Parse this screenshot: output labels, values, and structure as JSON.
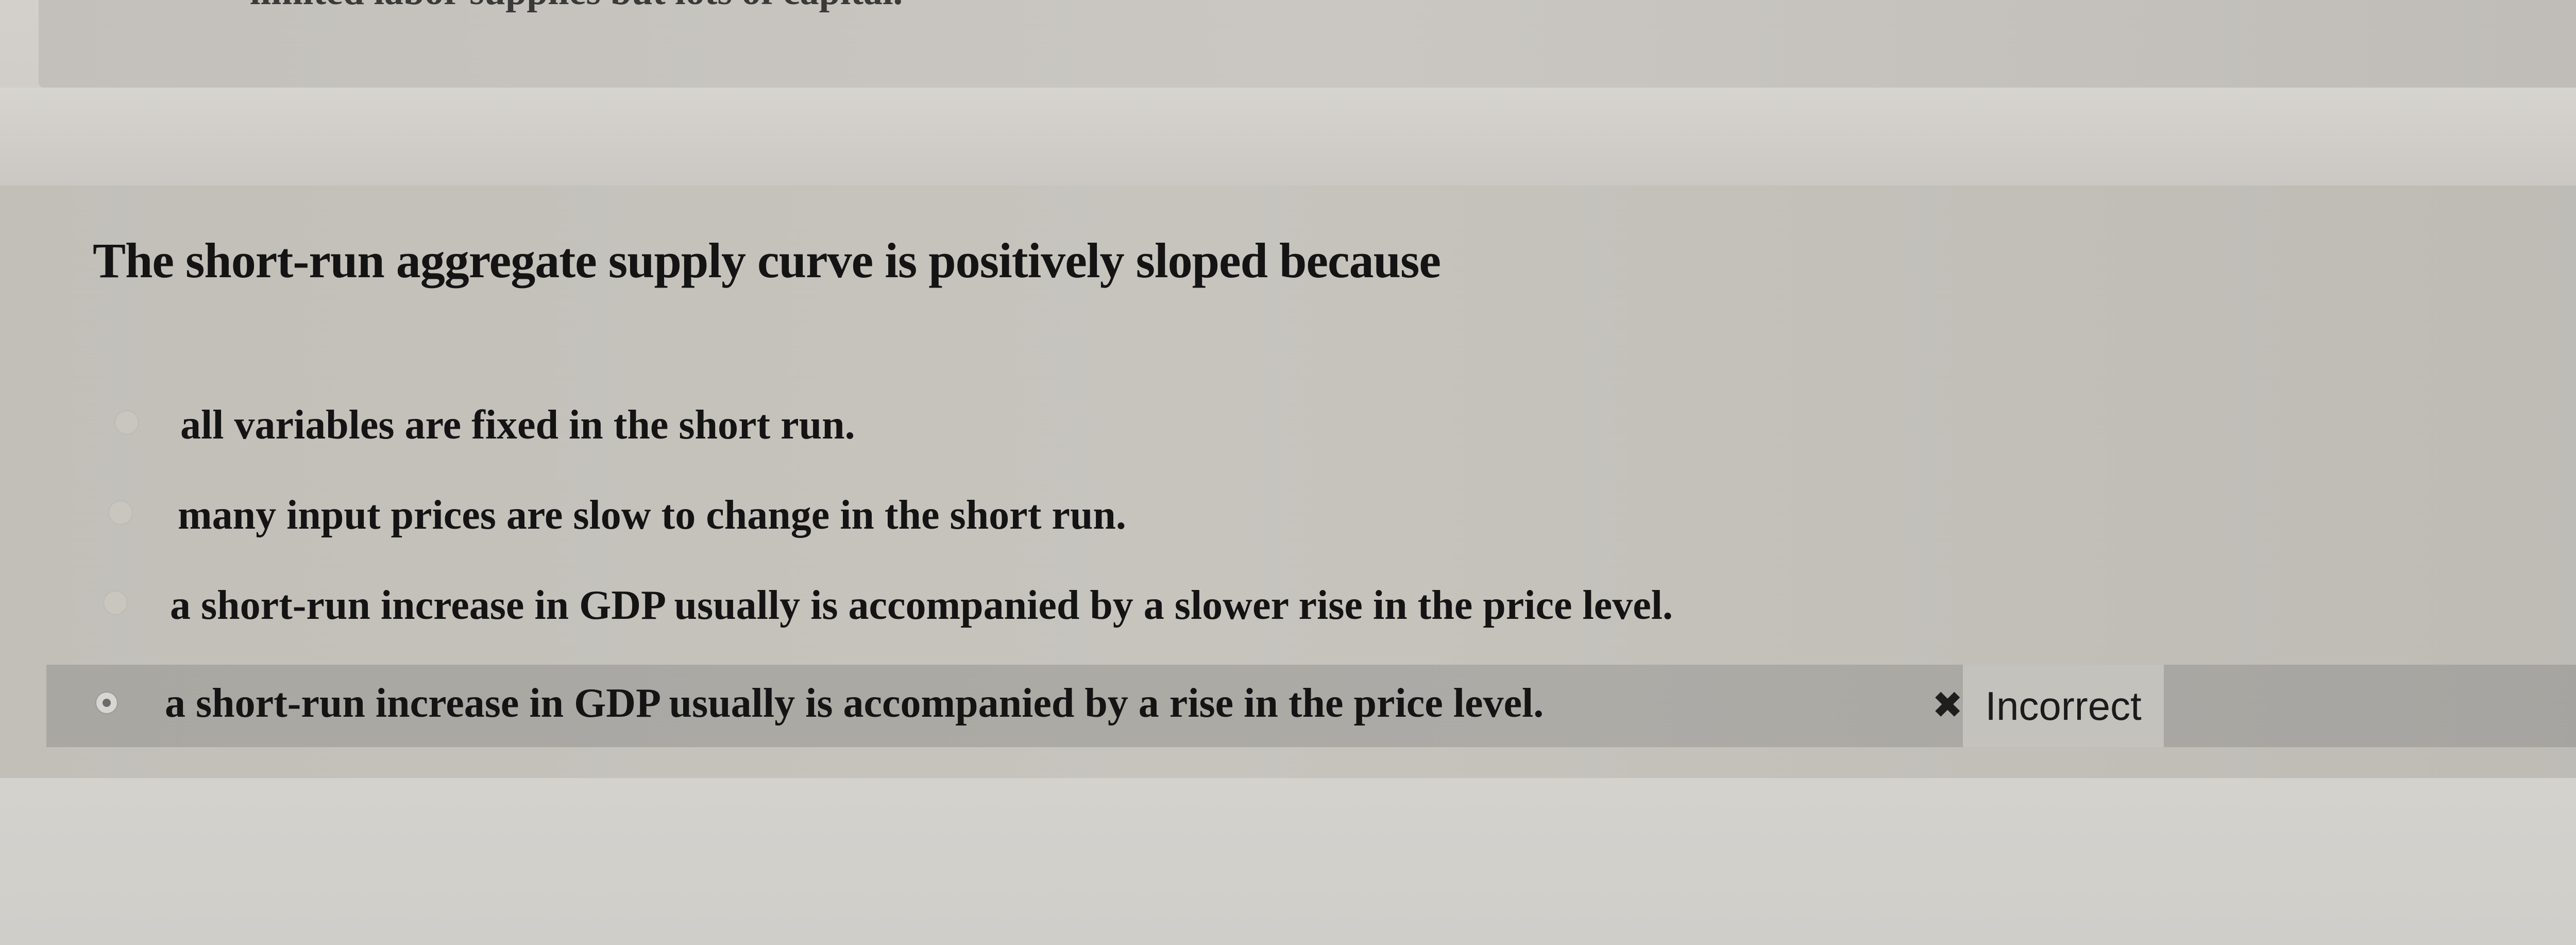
{
  "previous_item": {
    "clipped_text": "limited labor supplies but lots of capital."
  },
  "question": {
    "prompt": "The short-run aggregate supply curve is positively sloped because",
    "options": [
      {
        "label": "all variables are fixed in the short run.",
        "selected": false
      },
      {
        "label": "many input prices are slow to change in the short run.",
        "selected": false
      },
      {
        "label": "a short-run increase in GDP usually is accompanied by a slower rise in the price level.",
        "selected": false
      },
      {
        "label": "a short-run increase in GDP usually is accompanied by a rise in the price level.",
        "selected": true
      }
    ],
    "feedback": {
      "icon": "x-icon",
      "text": "Incorrect"
    }
  },
  "colors": {
    "background": "#cfccc7",
    "card": "#c4c1bb",
    "selected_row": "#aaa8a3",
    "text": "#141414"
  }
}
